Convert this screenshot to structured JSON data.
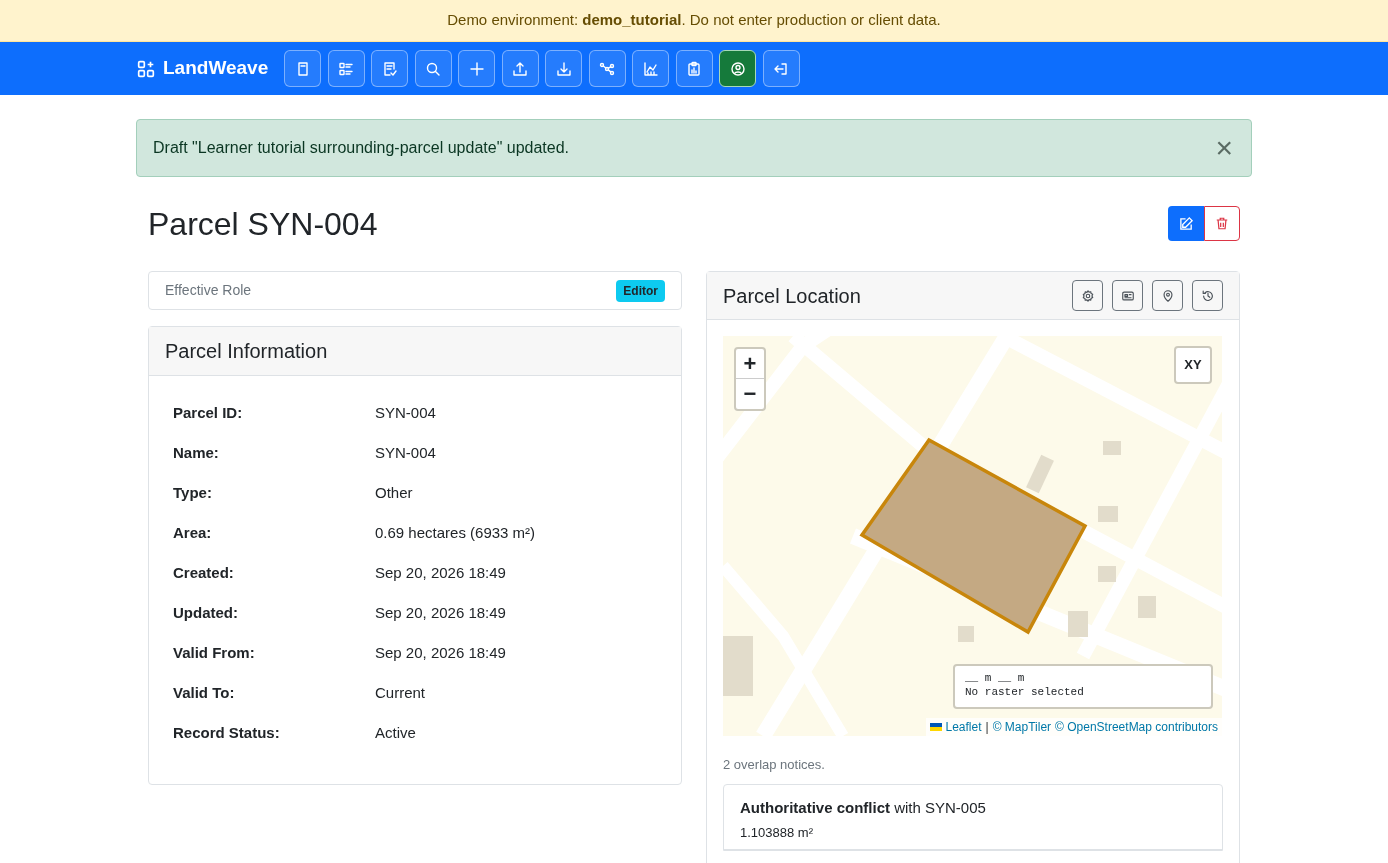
{
  "banner": {
    "text": "Demo environment: **demo_tutorial**. Do not enter production or client data."
  },
  "navbar": {
    "brand": "LandWeave",
    "buttons": [
      {
        "selected": false
      },
      {
        "selected": false
      },
      {
        "selected": false
      },
      {
        "selected": false
      },
      {
        "selected": false
      },
      {
        "selected": false
      },
      {
        "selected": false
      },
      {
        "selected": false
      },
      {
        "selected": false
      },
      {
        "selected": false
      },
      {
        "selected": true
      },
      {
        "selected": false
      }
    ]
  },
  "alert": {
    "text": "Draft \"Learner tutorial surrounding-parcel update\" updated.",
    "close": "×"
  },
  "title": "Parcel SYN-004",
  "role": {
    "label": "Effective Role",
    "badge": "Editor"
  },
  "info": {
    "title": "Parcel Information",
    "rows": [
      {
        "label": "Parcel ID:",
        "value": "SYN-004"
      },
      {
        "label": "Name:",
        "value": "SYN-004"
      },
      {
        "label": "Type:",
        "value": "Other"
      },
      {
        "label": "Area:",
        "value": "0.69 hectares (6933 m²)"
      },
      {
        "label": "Created:",
        "value": "Sep 20, 2026 18:49"
      },
      {
        "label": "Updated:",
        "value": "Sep 20, 2026 18:49"
      },
      {
        "label": "Valid From:",
        "value": "Sep 20, 2026 18:49"
      },
      {
        "label": "Valid To:",
        "value": "Current"
      },
      {
        "label": "Record Status:",
        "value": "Active"
      }
    ]
  },
  "location": {
    "title": "Parcel Location",
    "map": {
      "zoom_in": "+",
      "zoom_out": "−",
      "xy": "XY",
      "scale": "__ m __ m",
      "raster": "No raster selected",
      "attribution": {
        "links": [
          "Leaflet",
          "© MapTiler",
          "© OpenStreetMap contributors"
        ],
        "separator": "|"
      }
    },
    "overlap_summary": "2 overlap notices.",
    "notices": [
      {
        "text": "**Authoritative conflict** with SYN-005",
        "area": "1.103888 m²"
      }
    ]
  }
}
